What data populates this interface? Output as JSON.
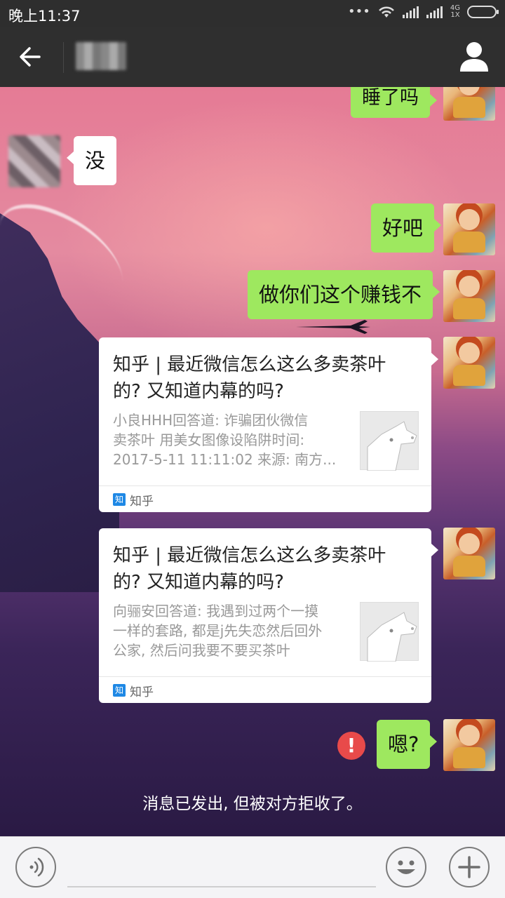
{
  "status_bar": {
    "time": "晚上11:37",
    "network": "4G",
    "network_sub": "1X",
    "dots": "•••"
  },
  "header": {
    "contact_name_blurred": ""
  },
  "messages": [
    {
      "side": "right",
      "text": "睡了吗"
    },
    {
      "side": "left",
      "text": "没"
    },
    {
      "side": "right",
      "text": "好吧"
    },
    {
      "side": "right",
      "text": "做你们这个赚钱不"
    }
  ],
  "cards": [
    {
      "title_line1": "知乎 | 最近微信怎么这么多卖茶叶",
      "title_line2": "的? 又知道内幕的吗?",
      "desc_lines": [
        "小良HHH回答道: 诈骗团伙微信",
        "卖茶叶 用美女图像设陷阱时间:",
        "2017-5-11 11:11:02 来源: 南方..."
      ],
      "source_icon": "知",
      "source": "知乎"
    },
    {
      "title_line1": "知乎 | 最近微信怎么这么多卖茶叶",
      "title_line2": "的? 又知道内幕的吗?",
      "desc_lines": [
        "向骊安回答道: 我遇到过两个一摸",
        "一样的套路, 都是j先失恋然后回外",
        "公家, 然后问我要不要买茶叶"
      ],
      "source_icon": "知",
      "source": "知乎"
    }
  ],
  "last_message": {
    "text": "嗯?",
    "fail_mark": "!"
  },
  "system_notice": "消息已发出, 但被对方拒收了。"
}
